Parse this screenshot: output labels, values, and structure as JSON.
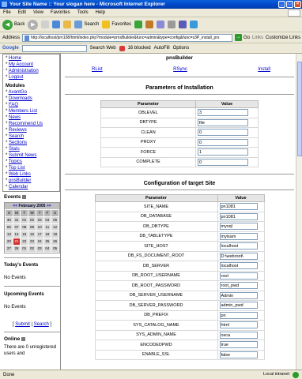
{
  "window": {
    "title": "Your Site Name :: Your slogan here - Microsoft Internet Explorer"
  },
  "menubar": [
    "File",
    "Edit",
    "View",
    "Favorites",
    "Tools",
    "Help"
  ],
  "toolbar": {
    "back": "Back",
    "search": "Search",
    "favorites": "Favorites"
  },
  "addressbar": {
    "label": "Address",
    "url": "http://localhost/prn108/html/index.php?module=prnsBuilder&func=admin&type=config&func=s3P_install_prs",
    "go": "Go",
    "links": "Links",
    "customize": "Customize Links"
  },
  "googlebar": {
    "brand": "Google",
    "search_web": "Search Web",
    "blocked": "16 blocked",
    "autofill": "AutoFill",
    "options": "Options"
  },
  "sidebar": {
    "top_links": [
      "Home",
      "My Account",
      "Administration",
      "Logout"
    ],
    "modules_title": "Modules",
    "modules": [
      "AvantGo",
      "Downloads",
      "FAQ",
      "Members List",
      "News",
      "Recommend Us",
      "Reviews",
      "Search",
      "Sections",
      "Stats",
      "Submit News",
      "Topics",
      "Top List",
      "Web Links",
      "pnsBuilder",
      "Calendar"
    ],
    "events_title": "Events",
    "calendar": {
      "prev": "<<",
      "month": "February 2005",
      "next": ">>",
      "dow": [
        "S",
        "M",
        "T",
        "W",
        "T",
        "F",
        "S"
      ],
      "weeks": [
        [
          "30",
          "31",
          "01",
          "02",
          "03",
          "04",
          "05"
        ],
        [
          "06",
          "07",
          "08",
          "09",
          "10",
          "11",
          "12"
        ],
        [
          "13",
          "14",
          "15",
          "16",
          "17",
          "18",
          "19"
        ],
        [
          "20",
          "21",
          "22",
          "23",
          "24",
          "25",
          "26"
        ],
        [
          "27",
          "28",
          "01",
          "02",
          "03",
          "04",
          "05"
        ]
      ],
      "today": "21"
    },
    "todays_events_title": "Today's Events",
    "todays_events_text": "No Events",
    "upcoming_title": "Upcoming Events",
    "upcoming_text": "No Events",
    "submit": "Submit",
    "search": "Search",
    "online_title": "Online",
    "online_text": "There are 0 unregistered users and"
  },
  "main": {
    "title": "pnsBuilder",
    "tabs": [
      "RList",
      "RSync",
      "Install"
    ],
    "install_title": "Parameters of Installation",
    "install_headers": [
      "Parameter",
      "Value"
    ],
    "install_params": [
      {
        "name": "DBLEVEL",
        "value": "3"
      },
      {
        "name": "DBTYPE",
        "value": "file"
      },
      {
        "name": "CLEAN",
        "value": "0"
      },
      {
        "name": "PROXY",
        "value": "0"
      },
      {
        "name": "FORCE",
        "value": "1"
      },
      {
        "name": "COMPLETE",
        "value": "0"
      }
    ],
    "config_title": "Configuration of target Site",
    "config_headers": [
      "Parameter",
      "Value"
    ],
    "config_params": [
      {
        "name": "SITE_NAME",
        "value": "pn1081"
      },
      {
        "name": "DB_DATABASE",
        "value": "pn1081"
      },
      {
        "name": "DB_DBTYPE",
        "value": "mysql"
      },
      {
        "name": "DB_TABLETYPE",
        "value": "myisam"
      },
      {
        "name": "SITE_HOST",
        "value": "localhost"
      },
      {
        "name": "DB_FS_DOCUMENT_ROOT",
        "value": "D:\\webroot\\"
      },
      {
        "name": "DB_SERVER",
        "value": "localhost"
      },
      {
        "name": "DB_ROOT_USERNAME",
        "value": "root"
      },
      {
        "name": "DB_ROOT_PASSWORD",
        "value": "root_pwd"
      },
      {
        "name": "DB_SERVER_USERNAME",
        "value": "Admin"
      },
      {
        "name": "DB_SERVER_PASSWORD",
        "value": "admin_pwd"
      },
      {
        "name": "DB_PREFIX",
        "value": "pn"
      },
      {
        "name": "SYS_CATALOG_NAME",
        "value": "html"
      },
      {
        "name": "SYS_ADMIN_NAME",
        "value": "osca"
      },
      {
        "name": "ENCODEDPWD",
        "value": "true"
      },
      {
        "name": "ENABLE_SSL",
        "value": "false"
      }
    ]
  },
  "statusbar": {
    "text": "Done",
    "zone": "Local intranet"
  }
}
